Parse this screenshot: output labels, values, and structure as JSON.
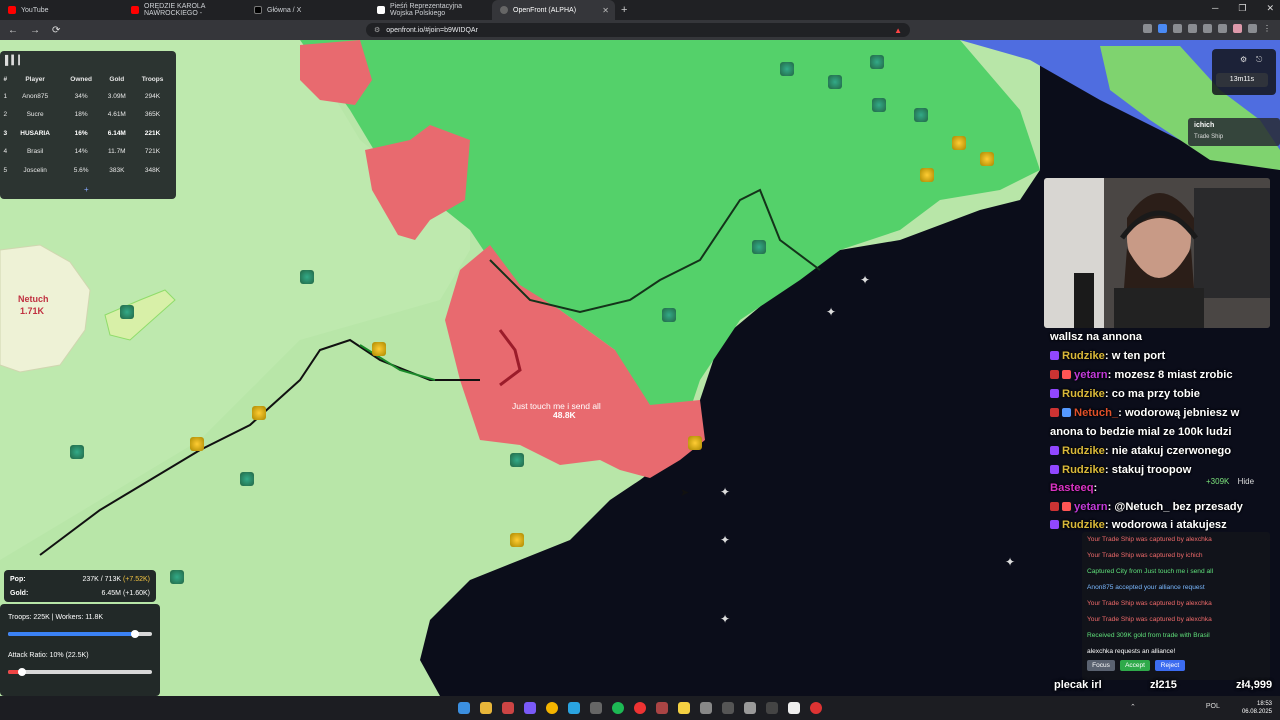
{
  "browser": {
    "tabs": [
      {
        "title": "YouTube",
        "color": "#ff0000"
      },
      {
        "title": "ORĘDZIE KAROLA NAWROCKIEGO -",
        "color": "#ff0000"
      },
      {
        "title": "Główna / X",
        "color": "#000000"
      },
      {
        "title": "Pieśń Reprezentacyjna Wojska Polskiego",
        "color": "#ffffff"
      },
      {
        "title": "OpenFront (ALPHA)",
        "color": "#444444",
        "close": "✕"
      }
    ],
    "new_tab": "+",
    "window_controls": [
      "─",
      "❐",
      "✕"
    ],
    "url": "openfront.io/#join=b9WIDQAr",
    "nav": [
      "←",
      "→",
      "⟳"
    ]
  },
  "leaderboard": {
    "headers": [
      "#",
      "Player",
      "Owned",
      "Gold",
      "Troops"
    ],
    "rows": [
      {
        "rank": "1",
        "player": "Anon875",
        "owned": "34%",
        "gold": "3.09M",
        "troops": "294K"
      },
      {
        "rank": "2",
        "player": "Sucre",
        "owned": "18%",
        "gold": "4.61M",
        "troops": "365K"
      },
      {
        "rank": "3",
        "player": "HUSARIA",
        "owned": "16%",
        "gold": "6.14M",
        "troops": "221K"
      },
      {
        "rank": "4",
        "player": "Brasil",
        "owned": "14%",
        "gold": "11.7M",
        "troops": "721K"
      },
      {
        "rank": "5",
        "player": "Joscelin",
        "owned": "5.6%",
        "gold": "383K",
        "troops": "348K"
      }
    ],
    "expand": "+"
  },
  "timer": {
    "value": "13m11s"
  },
  "trade_tooltip": {
    "name": "ichich",
    "subtitle": "Trade Ship"
  },
  "map": {
    "netuch_label": "Netuch",
    "netuch_troops": "1.71K",
    "enemy_name": "Just touch me i send all",
    "enemy_troops": "48.8K"
  },
  "chat": [
    {
      "user": "",
      "text": "wallsz na annona",
      "color": "#ffffff"
    },
    {
      "user": "Rudzike",
      "text": ": w ten port",
      "color": "#d9b83a"
    },
    {
      "user": "yetarn",
      "text": ": mozesz 8 miast zrobic",
      "color": "#c03bd9"
    },
    {
      "user": "Rudzike",
      "text": ": co ma przy tobie",
      "color": "#d9b83a"
    },
    {
      "user": "Netuch_",
      "text": ": wodorową jebniesz w",
      "color": "#e0502a"
    },
    {
      "user": "",
      "text": "anona to bedzie mial ze 100k ludzi",
      "color": "#ffffff"
    },
    {
      "user": "Rudzike",
      "text": ": nie atakuj czerwonego",
      "color": "#d9b83a"
    },
    {
      "user": "Rudzike",
      "text": ": stakuj troopow",
      "color": "#d9b83a"
    },
    {
      "user": "Basteeq",
      "text": ":",
      "color": "#d933c4"
    },
    {
      "user": "yetarn",
      "text": ": @Netuch_ bez przesady",
      "color": "#c03bd9"
    },
    {
      "user": "Rudzike",
      "text": ": wodorowa i atakujesz",
      "color": "#d9b83a"
    }
  ],
  "chat_gold": {
    "amount": "+309K",
    "hide": "Hide"
  },
  "events": [
    {
      "text": "Your Trade Ship was captured by alexchka",
      "color": "#f06a6a"
    },
    {
      "text": "Your Trade Ship was captured by ichich",
      "color": "#f06a6a"
    },
    {
      "text": "Captured City from Just touch me i send all",
      "color": "#5fe07a"
    },
    {
      "text": "Anon875 accepted your alliance request",
      "color": "#7ab8ff"
    },
    {
      "text": "Your Trade Ship was captured by alexchka",
      "color": "#f06a6a"
    },
    {
      "text": "Your Trade Ship was captured by alexchka",
      "color": "#f06a6a"
    },
    {
      "text": "Received 309K gold from trade with Brasil",
      "color": "#5fe07a"
    },
    {
      "text": "alexchka requests an alliance!",
      "color": "#ffffff"
    }
  ],
  "event_buttons": {
    "focus": "Focus",
    "accept": "Accept",
    "reject": "Reject"
  },
  "stats": {
    "pop_label": "Pop:",
    "pop_value": "237K / 713K",
    "pop_delta": "(+7.52K)",
    "gold_label": "Gold:",
    "gold_value": "6.45M (+1.60K)",
    "troops_text": "Troops: 225K | Workers: 11.8K",
    "troops_ratio": 0.88,
    "attack_text": "Attack Ratio: 10% (22.5K)",
    "attack_ratio": 0.1
  },
  "donations": {
    "plecak": "plecak irl",
    "zl1": "zł215",
    "zl2": "zł4,999"
  },
  "tray": {
    "lang": "POL",
    "time": "18:53",
    "date": "06.08.2025"
  },
  "colors": {
    "land": "#b8e6a8",
    "ally": "#54d16a",
    "enemy": "#e86a6f",
    "water": "#0b0d1a",
    "ocean_ne": "#4f6de0"
  }
}
